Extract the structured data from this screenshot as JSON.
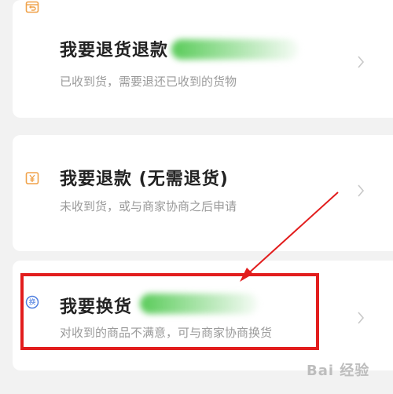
{
  "options": [
    {
      "title": "我要退货退款",
      "subtitle": "已收到货，需要退还已收到的货物",
      "icon": "return-refund-icon"
    },
    {
      "title": "我要退款 (无需退货)",
      "subtitle": "未收到货，或与商家协商之后申请",
      "icon": "refund-only-icon"
    },
    {
      "title": "我要换货",
      "subtitle": "对收到的商品不满意，可与商家协商换货",
      "icon": "exchange-icon",
      "icon_char": "换"
    }
  ],
  "colors": {
    "icon_orange": "#f0a24a",
    "icon_blue": "#4f7fe0",
    "highlight_red": "#e21d1d",
    "arrow_red": "#e21d1d"
  },
  "watermark": "Bai 经验"
}
